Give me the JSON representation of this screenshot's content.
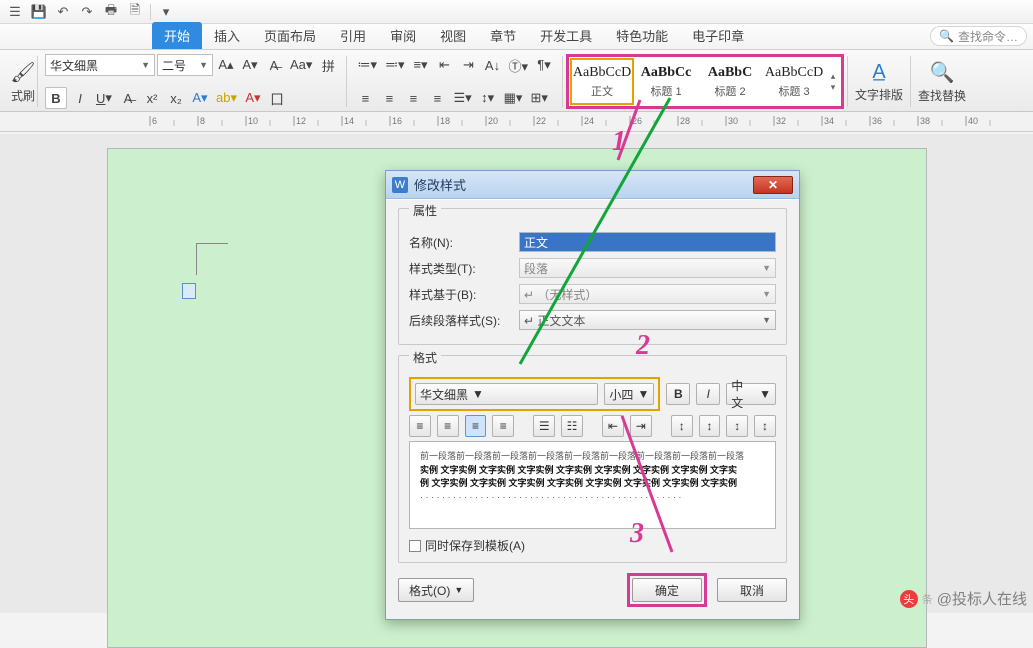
{
  "qat_icons": [
    "menu",
    "save",
    "undo",
    "redo",
    "print",
    "print-preview",
    "sep",
    "new",
    "open",
    "sep",
    "more"
  ],
  "tabs": [
    "开始",
    "插入",
    "页面布局",
    "引用",
    "审阅",
    "视图",
    "章节",
    "开发工具",
    "特色功能",
    "电子印章"
  ],
  "tabs_active_index": 0,
  "search": {
    "placeholder": "查找命令…"
  },
  "ribbon": {
    "clipboard_label": "式刷",
    "font_name": "华文细黑",
    "font_size": "二号",
    "styles": [
      {
        "sample": "AaBbCcD",
        "label": "正文",
        "selected": true
      },
      {
        "sample": "AaBbCc",
        "label": "标题 1",
        "selected": false
      },
      {
        "sample": "AaBbC",
        "label": "标题 2",
        "selected": false
      },
      {
        "sample": "AaBbCcD",
        "label": "标题 3",
        "selected": false
      }
    ],
    "text_layout_label": "文字排版",
    "find_replace_label": "查找替换"
  },
  "ruler_ticks": [
    6,
    8,
    10,
    12,
    14,
    16,
    18,
    20,
    22,
    24,
    26,
    28,
    30,
    32,
    34,
    36,
    38,
    40
  ],
  "dialog": {
    "title": "修改样式",
    "group_props": "属性",
    "fields": {
      "name_label": "名称(N):",
      "name_value": "正文",
      "type_label": "样式类型(T):",
      "type_value": "段落",
      "based_label": "样式基于(B):",
      "based_value": "↵ （无样式）",
      "next_label": "后续段落样式(S):",
      "next_value": "↵ 正文文本"
    },
    "group_format": "格式",
    "format": {
      "font_name": "华文细黑",
      "font_size": "小四",
      "lang": "中文"
    },
    "align_buttons": [
      "left",
      "center",
      "right",
      "justify",
      "dist1",
      "dist2",
      "indent-dec",
      "indent-inc",
      "line-dec",
      "line-inc",
      "line-inc2",
      "line-inc3"
    ],
    "preview_lines": [
      "前一段落前一段落前一段落前一段落前一段落前一段落前一段落前一段落前一段落",
      "实例 文字实例 文字实例 文字实例 文字实例 文字实例 文字实例 文字实例 文字实",
      "例 文字实例 文字实例 文字实例 文字实例 文字实例 文字实例 文字实例 文字实例",
      "· · · · · · · · · · · · · · · · · · · · · · · · · · · · · · · · · · · · · · · · · · · · · · · ·"
    ],
    "save_tpl": "同时保存到模板(A)",
    "format_btn": "格式(O)",
    "ok": "确定",
    "cancel": "取消"
  },
  "annotations": {
    "n1": "1",
    "n2": "2",
    "n3": "3"
  },
  "watermark": {
    "text": "@投标人在线"
  }
}
